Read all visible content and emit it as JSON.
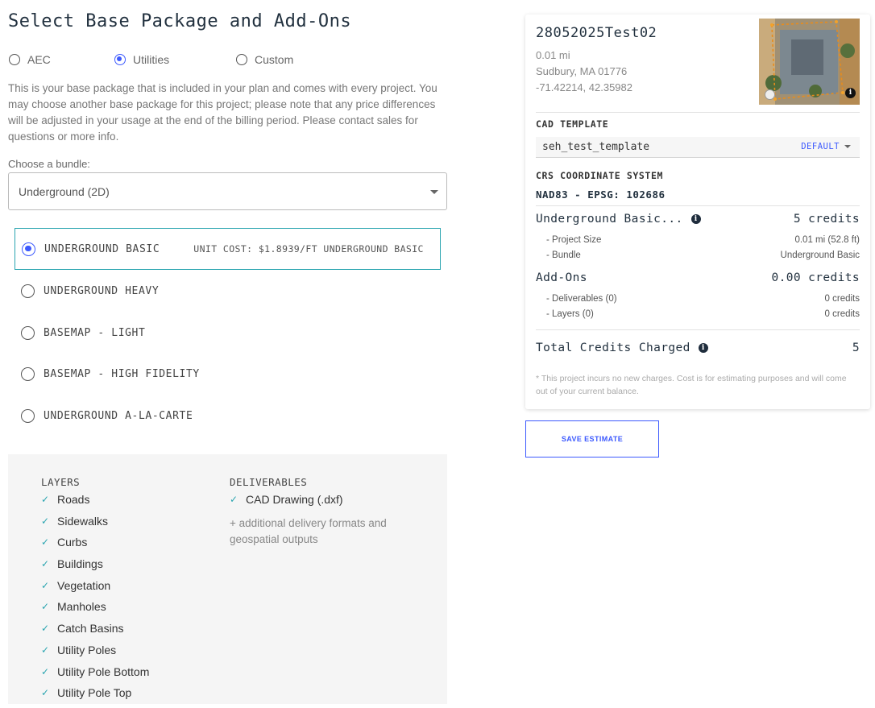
{
  "title": "Select Base Package and Add-Ons",
  "packages": [
    {
      "label": "AEC",
      "selected": false
    },
    {
      "label": "Utilities",
      "selected": true
    },
    {
      "label": "Custom",
      "selected": false
    }
  ],
  "description": "This is your base package that is included in your plan and comes with every project. You may choose another base package for this project; please note that any price differences will be adjusted in your usage at the end of the billing period. Please contact sales for questions or more info.",
  "bundle": {
    "label": "Choose a bundle:",
    "value": "Underground (2D)"
  },
  "bundle_options": [
    {
      "name": "UNDERGROUND BASIC",
      "unit_cost": "UNIT COST: $1.8939/FT UNDERGROUND BASIC",
      "selected": true
    },
    {
      "name": "UNDERGROUND HEAVY",
      "selected": false
    },
    {
      "name": "BASEMAP - LIGHT",
      "selected": false
    },
    {
      "name": "BASEMAP - HIGH FIDELITY",
      "selected": false
    },
    {
      "name": "UNDERGROUND A-LA-CARTE",
      "selected": false
    }
  ],
  "features": {
    "layers_heading": "LAYERS",
    "layers": [
      "Roads",
      "Sidewalks",
      "Curbs",
      "Buildings",
      "Vegetation",
      "Manholes",
      "Catch Basins",
      "Utility Poles",
      "Utility Pole Bottom",
      "Utility Pole Top"
    ],
    "deliverables_heading": "DELIVERABLES",
    "deliverables": [
      "CAD Drawing (.dxf)"
    ],
    "more": "+ additional delivery formats and geospatial outputs"
  },
  "project": {
    "name": "28052025Test02",
    "distance": "0.01 mi",
    "location": "Sudbury, MA 01776",
    "coords": "-71.42214, 42.35982"
  },
  "cad_template": {
    "label": "CAD TEMPLATE",
    "value": "seh_test_template",
    "default_label": "DEFAULT"
  },
  "crs": {
    "label": "CRS COORDINATE SYSTEM",
    "value": "NAD83 - EPSG: 102686"
  },
  "summary": {
    "base_label": "Underground Basic...",
    "base_credits": "5 credits",
    "project_size_label": "- Project Size",
    "project_size_value": "0.01 mi (52.8 ft)",
    "bundle_label": "- Bundle",
    "bundle_value": "Underground Basic",
    "addons_label": "Add-Ons",
    "addons_credits": "0.00 credits",
    "deliverables_label": "- Deliverables (0)",
    "deliverables_value": "0 credits",
    "layers_label": "- Layers (0)",
    "layers_value": "0 credits",
    "total_label": "Total Credits Charged",
    "total_value": "5",
    "note": "* This project incurs no new charges. Cost is for estimating purposes and will come out of your current balance."
  },
  "save_button": "SAVE ESTIMATE",
  "colors": {
    "accent": "#3d5afe",
    "teal": "#2aa5b0",
    "heading": "#22313f"
  }
}
